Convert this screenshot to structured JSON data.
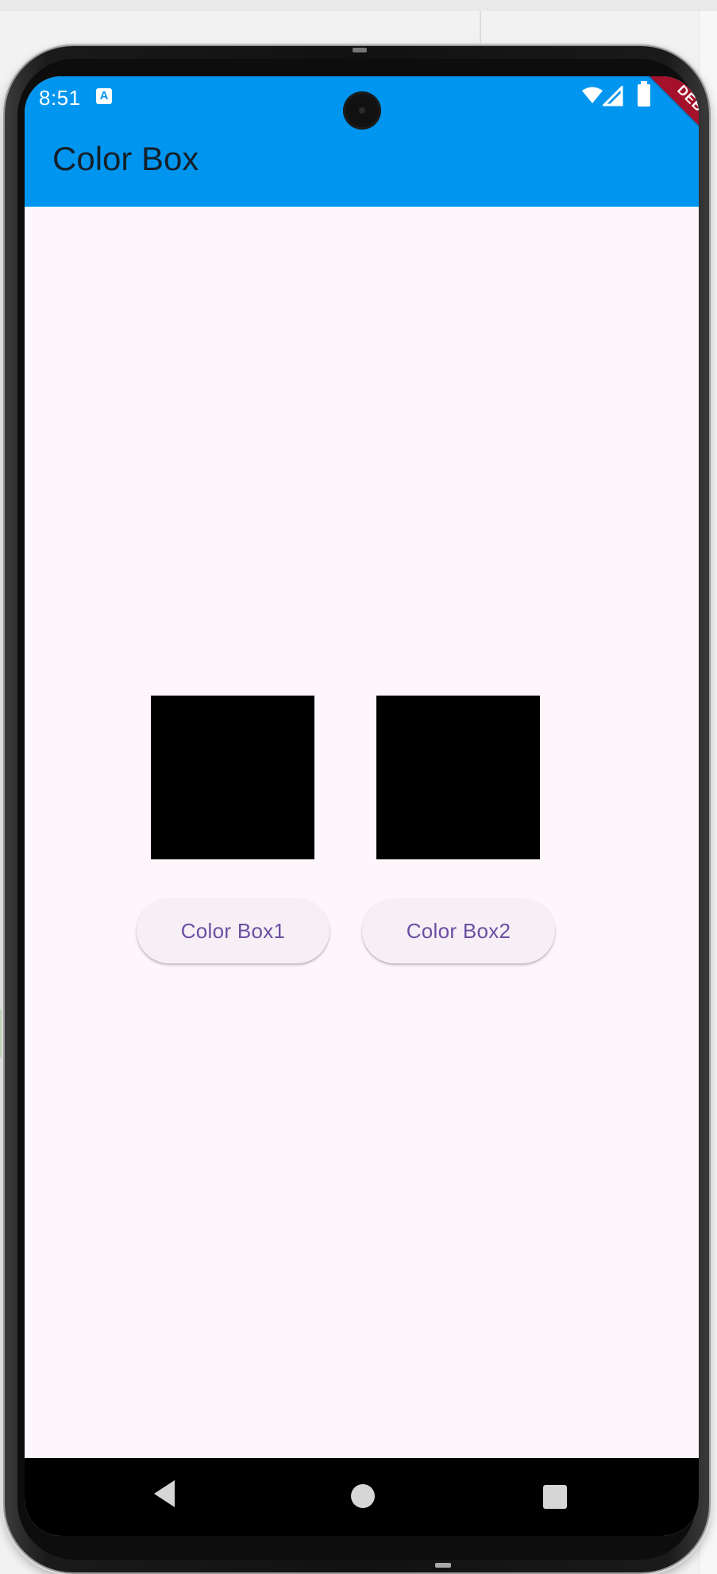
{
  "status_bar": {
    "time": "8:51",
    "notification_icon": "A",
    "icons": [
      "wifi-icon",
      "signal-icon",
      "battery-icon"
    ]
  },
  "app_bar": {
    "title": "Color Box",
    "color": "#0096f0",
    "debug_banner": "DEBUG"
  },
  "boxes": [
    {
      "color": "#000000"
    },
    {
      "color": "#000000"
    }
  ],
  "buttons": [
    {
      "label": "Color Box1"
    },
    {
      "label": "Color Box2"
    }
  ],
  "nav_bar": {
    "icons": [
      "back-icon",
      "home-icon",
      "recents-icon"
    ]
  }
}
